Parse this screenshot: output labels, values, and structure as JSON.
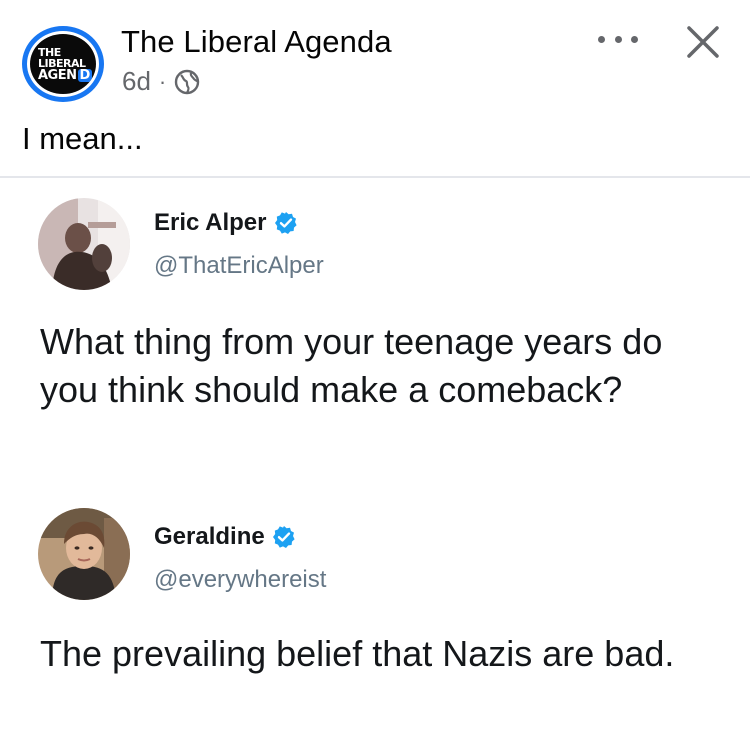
{
  "post": {
    "page_name": "The Liberal Agenda",
    "logo_text": [
      "THE",
      "LIBERAL",
      "AGENDA"
    ],
    "time": "6d",
    "separator": "·",
    "visibility_icon": "globe-icon",
    "caption": "I mean..."
  },
  "tweets": [
    {
      "name": "Eric Alper",
      "handle": "@ThatEricAlper",
      "text": "What thing from your teenage years do you think should make a comeback?",
      "verified": true
    },
    {
      "name": "Geraldine",
      "handle": "@everywhereist",
      "text": "The prevailing belief that Nazis are bad.",
      "verified": true
    }
  ],
  "colors": {
    "accent": "#1877f2",
    "verified": "#1da1f2",
    "meta_text": "#65676b",
    "handle_text": "#657786"
  },
  "icons": {
    "more": "more-icon",
    "close": "close-icon",
    "verified": "verified-badge-icon"
  }
}
